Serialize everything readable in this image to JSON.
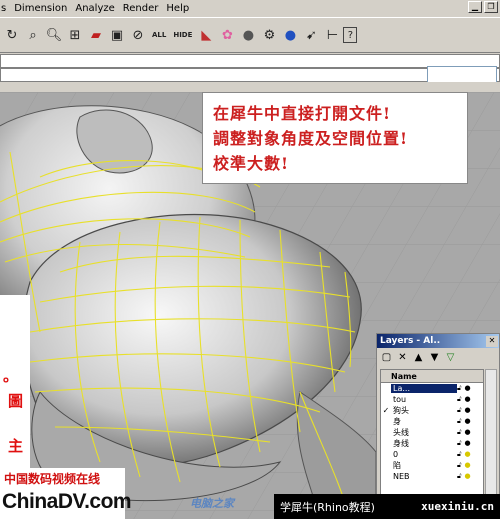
{
  "menu": {
    "items": [
      "s",
      "Dimension",
      "Analyze",
      "Render",
      "Help"
    ]
  },
  "toolbar": {
    "icons": [
      "rotate-icon",
      "zoom-window-icon",
      "zoom-icon",
      "zoom-extents-icon",
      "car-shade-icon",
      "box-shade-icon",
      "clear-icon"
    ],
    "text_buttons": [
      "ALL",
      "HIDE"
    ],
    "render_icons": [
      "render-color-icon",
      "color-wheel-icon",
      "sphere-icon",
      "gear-icon",
      "blue-sphere-icon",
      "cursor-icon",
      "dim-icon",
      "help-icon"
    ]
  },
  "command": {
    "history": "",
    "prompt": "",
    "coordinate": ""
  },
  "annotation": {
    "line1": "在犀牛中直接打開文件!",
    "line2": "調整對象角度及空間位置!",
    "line3": "校準大數!"
  },
  "left_strip": {
    "chars": [
      "。",
      "圖",
      "主"
    ]
  },
  "layers_panel": {
    "title": "Layers - Al..",
    "header": "Name",
    "rows": [
      {
        "check": "",
        "name": "La...",
        "selected": true
      },
      {
        "check": "",
        "name": "tou",
        "selected": false
      },
      {
        "check": "✓",
        "name": "狗头",
        "selected": false
      },
      {
        "check": "",
        "name": "身",
        "selected": false
      },
      {
        "check": "",
        "name": "头线",
        "selected": false
      },
      {
        "check": "",
        "name": "身线",
        "selected": false
      },
      {
        "check": "",
        "name": "0",
        "selected": false
      },
      {
        "check": "",
        "name": "陷",
        "selected": false
      },
      {
        "check": "",
        "name": "NEB",
        "selected": false
      }
    ]
  },
  "watermarks": {
    "brand_cn": "中国数码视频在线",
    "brand_en": "ChinaDV.com",
    "mid": "电脑之家",
    "footer_left": "学犀牛(Rhino教程)",
    "footer_url": "xuexiniu.cn"
  },
  "colors": {
    "annotation_text": "#cc2020",
    "curve": "#e8e02a",
    "layer_selected": "#0a246a"
  }
}
